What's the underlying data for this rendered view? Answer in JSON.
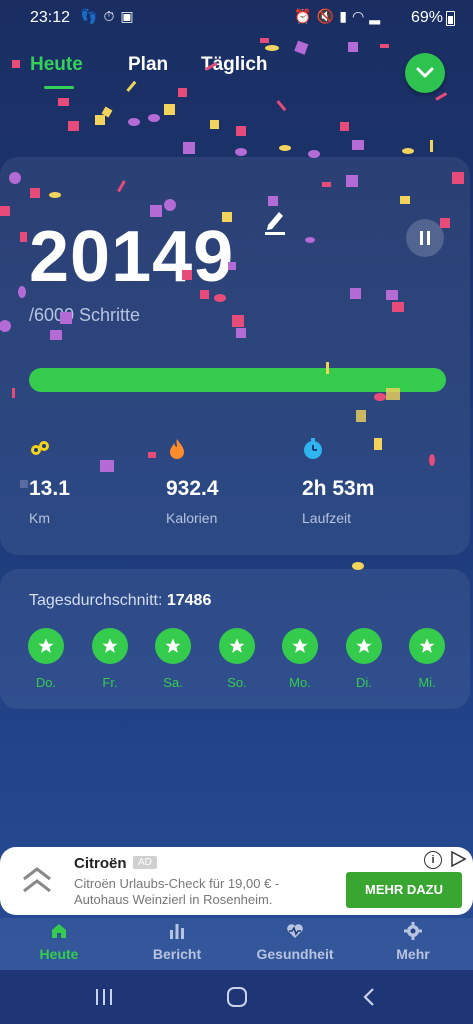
{
  "status_bar": {
    "time": "23:12",
    "battery": "69%",
    "left_icons": [
      "footsteps-icon",
      "timer-icon",
      "app-icon"
    ],
    "right_icons": [
      "alarm-off-icon",
      "mute-icon",
      "sim-icon",
      "wifi-icon",
      "signal-icon"
    ]
  },
  "tabs": [
    {
      "label": "Heute",
      "active": true
    },
    {
      "label": "Plan",
      "active": false
    },
    {
      "label": "Täglich",
      "active": false
    }
  ],
  "today": {
    "steps": "20149",
    "goal": "/6000 Schritte",
    "progress": 1.0,
    "metrics": [
      {
        "icon": "distance-icon",
        "value": "13.1",
        "label": "Km",
        "color": "#f5d31a"
      },
      {
        "icon": "flame-icon",
        "value": "932.4",
        "label": "Kalorien",
        "color": "#ff8c2a"
      },
      {
        "icon": "stopwatch-icon",
        "value": "2h 53m",
        "label": "Laufzeit",
        "color": "#2fb4f0"
      }
    ]
  },
  "average": {
    "label": "Tagesdurchschnitt:",
    "value": "17486",
    "days": [
      "Do.",
      "Fr.",
      "Sa.",
      "So.",
      "Mo.",
      "Di.",
      "Mi."
    ]
  },
  "ad": {
    "brand": "Citroën",
    "badge": "AD",
    "text": "Citroën Urlaubs-Check für 19,00 € - Autohaus Weinzierl in Rosenheim.",
    "cta": "MEHR DAZU"
  },
  "bottom_nav": [
    {
      "label": "Heute",
      "icon": "home-icon",
      "active": true
    },
    {
      "label": "Bericht",
      "icon": "bar-chart-icon",
      "active": false
    },
    {
      "label": "Gesundheit",
      "icon": "heart-rate-icon",
      "active": false
    },
    {
      "label": "Mehr",
      "icon": "gear-icon",
      "active": false
    }
  ],
  "colors": {
    "accent": "#35cc4e",
    "background": "#1d3a78",
    "muted_text": "#b7c3df"
  }
}
